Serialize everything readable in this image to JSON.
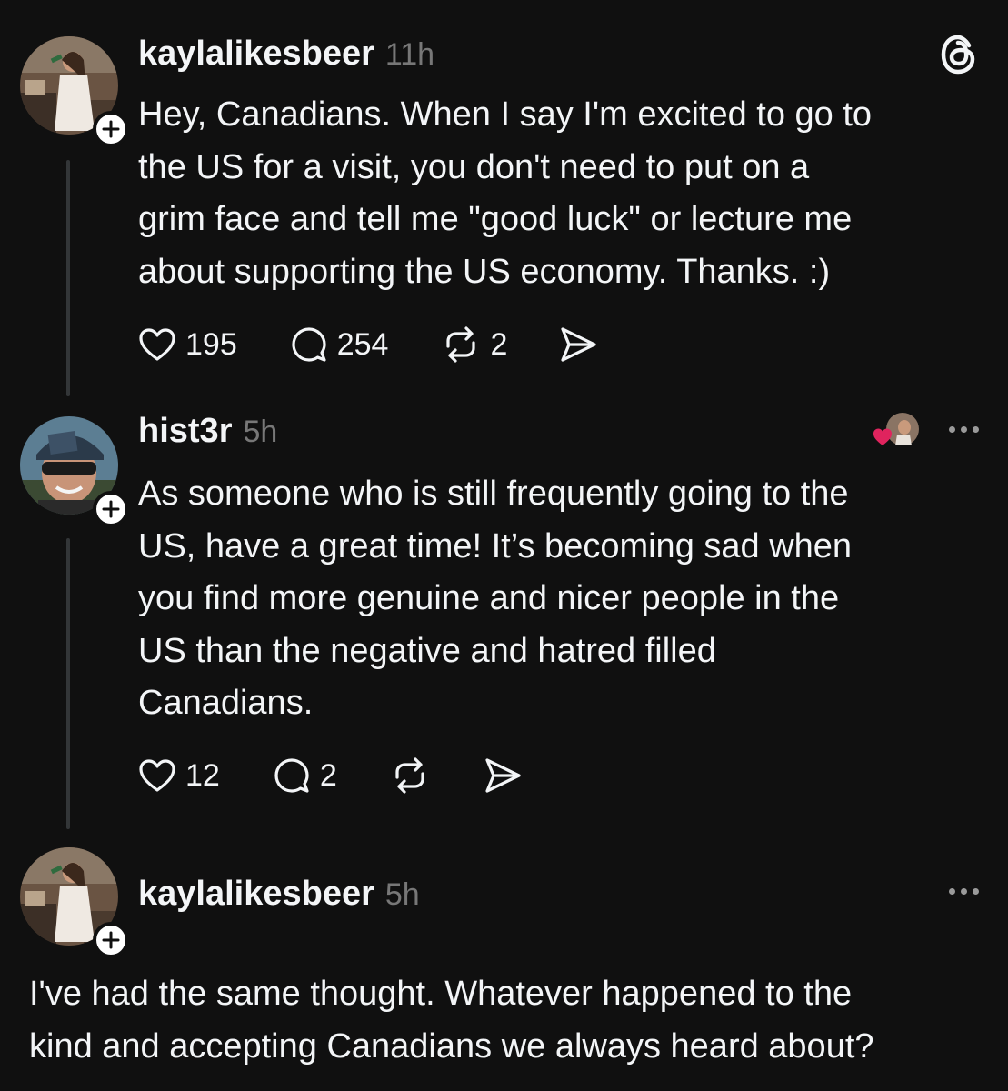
{
  "posts": [
    {
      "username": "kaylalikesbeer",
      "time": "11h",
      "text": "Hey, Canadians. When I say I'm excited to go to\nthe US for a visit, you don't need to put on a\ngrim face and tell me \"good luck\" or lecture me\nabout supporting the US economy. Thanks. :)",
      "likes": "195",
      "replies": "254",
      "reposts": "2"
    },
    {
      "username": "hist3r",
      "time": "5h",
      "text": "As someone who is still frequently going to the\nUS, have a great time! It’s becoming sad when\nyou find more genuine and nicer people in the\nUS than the negative and hatred filled\nCanadians.",
      "likes": "12",
      "replies": "2",
      "reposts": ""
    },
    {
      "username": "kaylalikesbeer",
      "time": "5h",
      "text": "I've had the same thought. Whatever happened to the\nkind and accepting Canadians we always heard about?"
    }
  ],
  "icons": {
    "app_logo": "threads-logo-icon",
    "like": "heart-icon",
    "reply": "comment-bubble-icon",
    "repost": "repost-icon",
    "share": "send-icon",
    "more": "more-dots-icon",
    "follow": "plus-icon"
  },
  "colors": {
    "background": "#101010",
    "text": "#f3f5f7",
    "muted": "#777777",
    "thread_line": "#333638",
    "liked_heart": "#e0245e"
  }
}
